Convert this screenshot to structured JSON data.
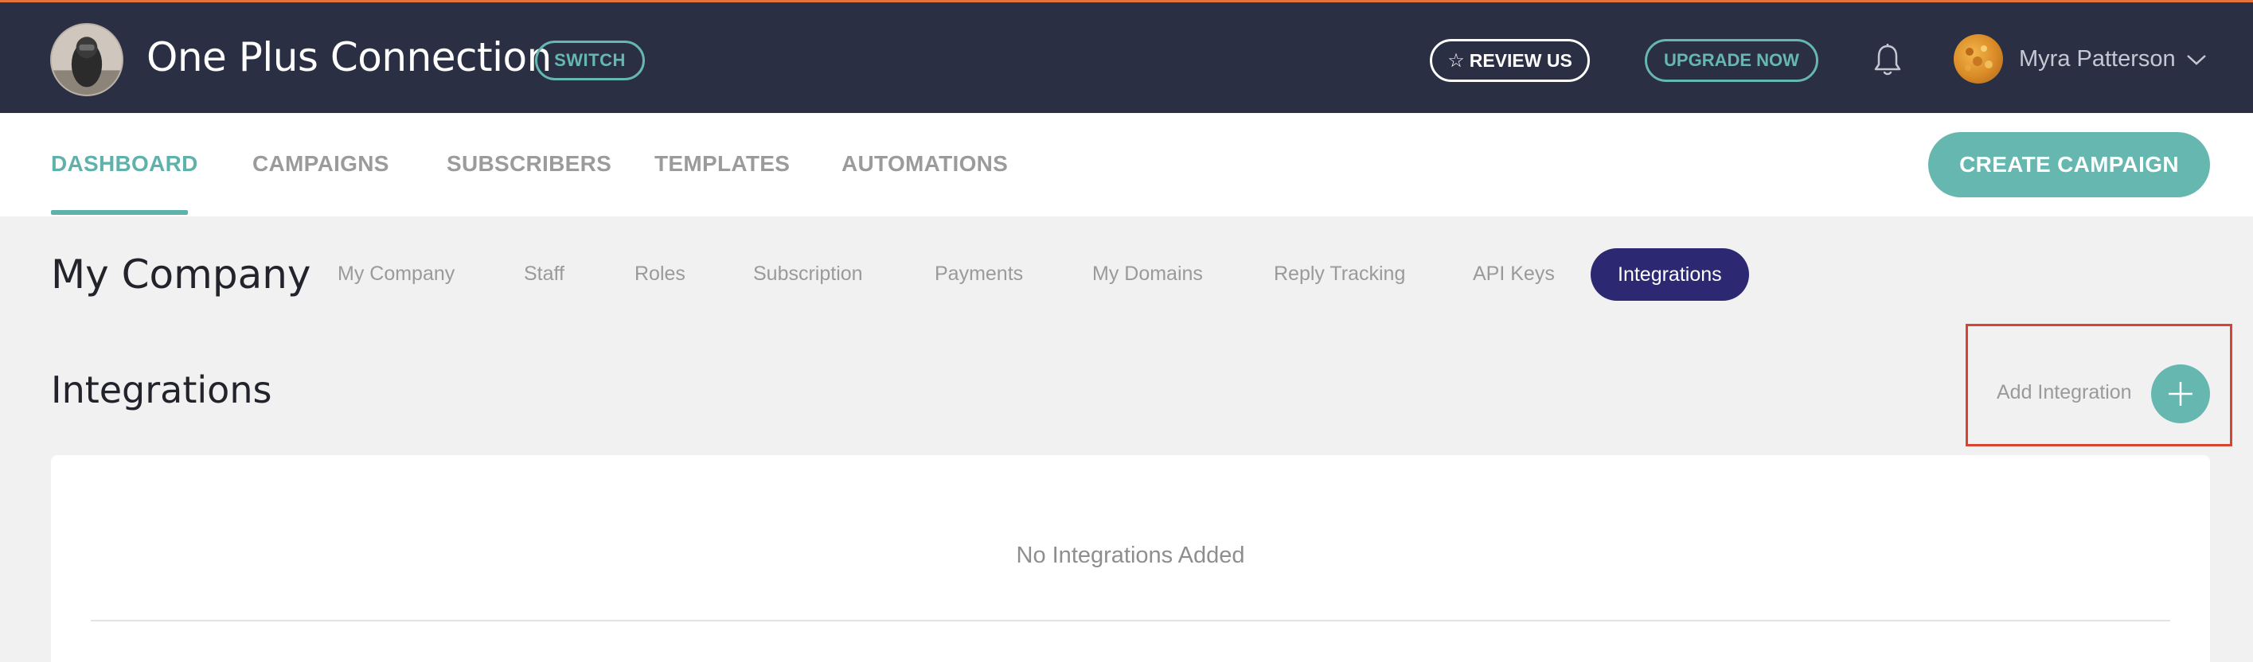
{
  "header": {
    "company_name": "One Plus Connection",
    "switch_label": "SWITCH",
    "review_label": "REVIEW US",
    "upgrade_label": "UPGRADE NOW",
    "user_name": "Myra Patterson",
    "icons": [
      "company-logo",
      "star-icon",
      "bell-icon",
      "user-avatar",
      "chevron-down-icon"
    ]
  },
  "nav": {
    "items": [
      {
        "label": "DASHBOARD",
        "active": true
      },
      {
        "label": "CAMPAIGNS"
      },
      {
        "label": "SUBSCRIBERS"
      },
      {
        "label": "TEMPLATES"
      },
      {
        "label": "AUTOMATIONS"
      }
    ],
    "create_label": "CREATE CAMPAIGN"
  },
  "subnav": {
    "title": "My Company",
    "items": [
      {
        "label": "My Company"
      },
      {
        "label": "Staff"
      },
      {
        "label": "Roles"
      },
      {
        "label": "Subscription"
      },
      {
        "label": "Payments"
      },
      {
        "label": "My Domains"
      },
      {
        "label": "Reply Tracking"
      },
      {
        "label": "API Keys"
      },
      {
        "label": "Integrations",
        "active": true
      }
    ]
  },
  "integrations": {
    "title": "Integrations",
    "add_label": "Add Integration",
    "empty_text": "No Integrations Added"
  },
  "colors": {
    "topbar": "#2a2f43",
    "accent_teal": "#66b7b0",
    "active_pill": "#2c2872",
    "highlight": "#d9432f",
    "top_border": "#e4733b"
  }
}
